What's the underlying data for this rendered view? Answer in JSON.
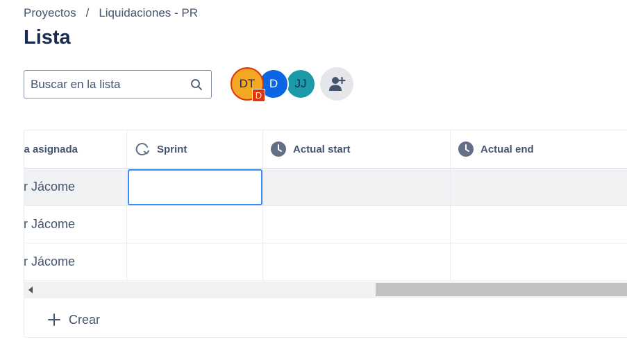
{
  "breadcrumb": {
    "items": [
      "Proyectos",
      "Liquidaciones - PR"
    ],
    "separator": "/"
  },
  "page": {
    "title": "Lista"
  },
  "search": {
    "placeholder": "Buscar en la lista",
    "value": ""
  },
  "avatars": [
    {
      "initials": "DT",
      "badge": "D",
      "color": "#f5a623",
      "ring": "#de350b"
    },
    {
      "initials": "D",
      "color": "#0c66e4"
    },
    {
      "initials": "JJ",
      "color": "#1d9aaa"
    }
  ],
  "add_people_icon": "add-person-icon",
  "table": {
    "columns": [
      {
        "label": "a asignada",
        "icon": ""
      },
      {
        "label": "Sprint",
        "icon": "sprint-icon"
      },
      {
        "label": "Actual start",
        "icon": "clock-icon"
      },
      {
        "label": "Actual end",
        "icon": "clock-icon"
      }
    ],
    "rows": [
      [
        "r Jácome",
        "",
        "",
        ""
      ],
      [
        "r Jácome",
        "",
        "",
        ""
      ],
      [
        "r Jácome",
        "",
        "",
        ""
      ]
    ]
  },
  "create": {
    "label": "Crear",
    "icon": "plus-icon"
  },
  "colors": {
    "accent": "#388bff",
    "text": "#172b4d",
    "subtle_text": "#44546f",
    "selected_row": "#f1f2f4"
  }
}
